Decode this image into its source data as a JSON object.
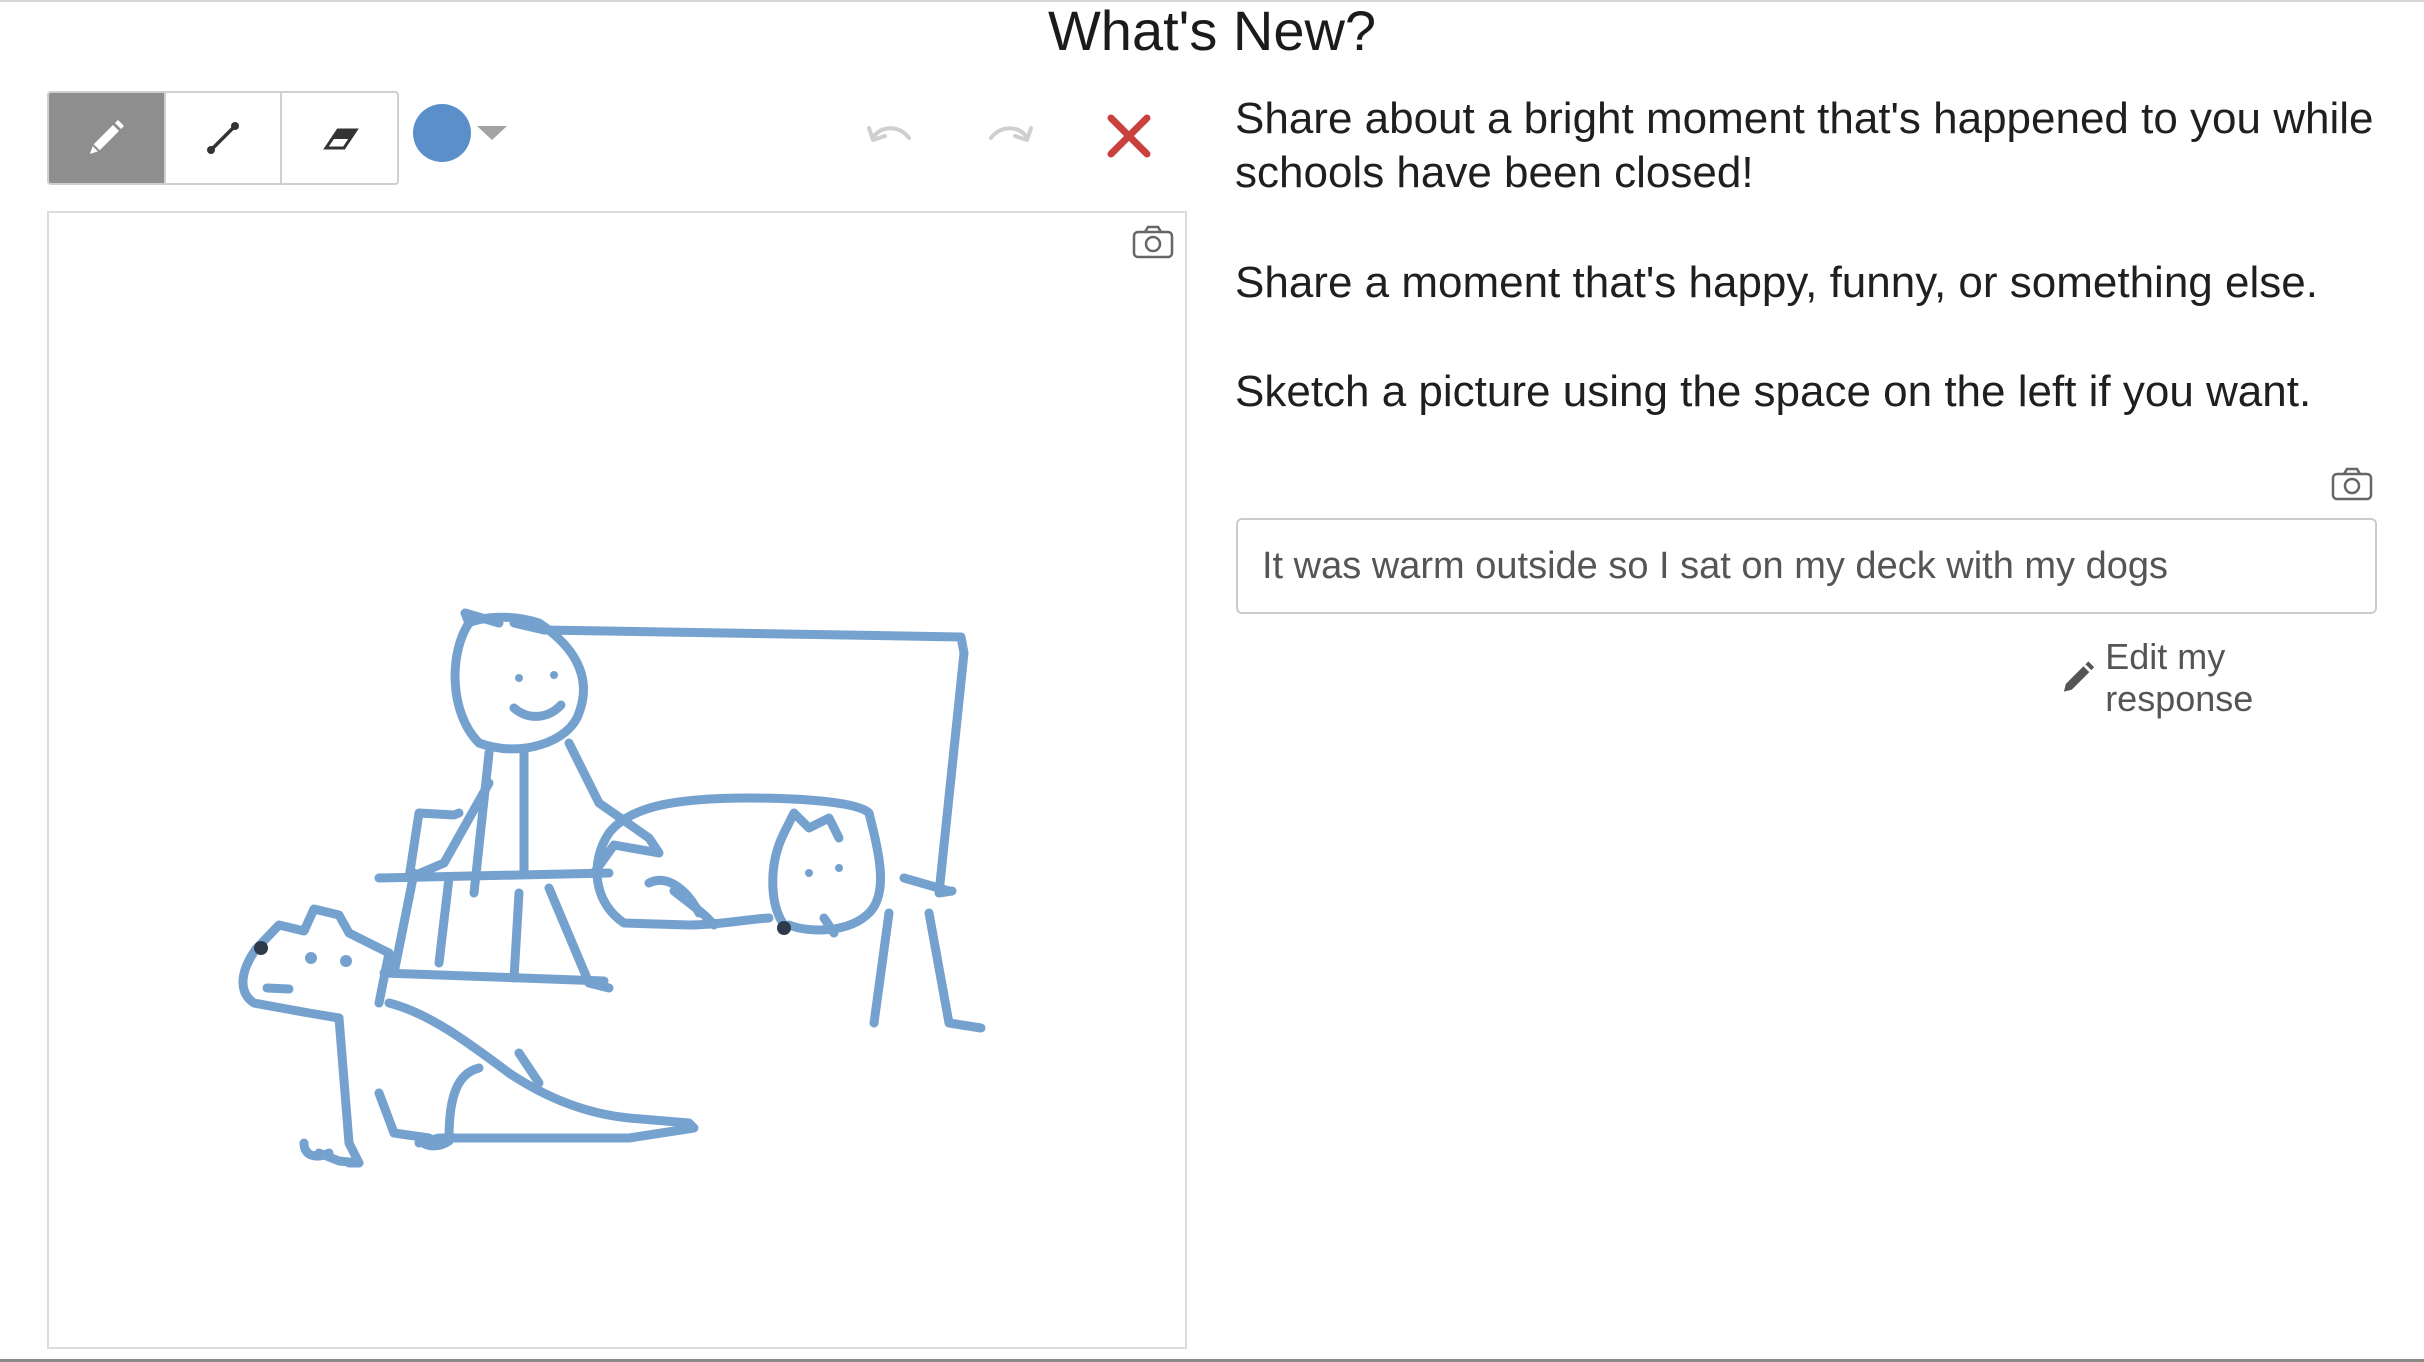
{
  "header": {
    "title": "What's New?"
  },
  "toolbar": {
    "tools": [
      {
        "icon": "pencil-icon",
        "active": true
      },
      {
        "icon": "line-icon",
        "active": false
      },
      {
        "icon": "eraser-icon",
        "active": false
      }
    ],
    "color": {
      "value": "#5b8fc9",
      "icon": "chevron-down-icon"
    },
    "undo_icon": "undo-icon",
    "redo_icon": "redo-icon",
    "clear_icon": "close-icon",
    "clear_color": "#c9403f"
  },
  "canvas": {
    "stroke_color": "#6a9acb",
    "camera_icon": "camera-icon"
  },
  "prompt": {
    "line1": "Share about a bright moment that's happened to you while schools have been closed!",
    "line2": "Share a moment that's happy, funny, or something else.",
    "line3": "Sketch a picture using the space on the left if you want."
  },
  "response": {
    "camera_icon": "camera-icon",
    "text": "It was warm outside so I sat on my deck with my dogs",
    "edit_label": "Edit my response"
  }
}
